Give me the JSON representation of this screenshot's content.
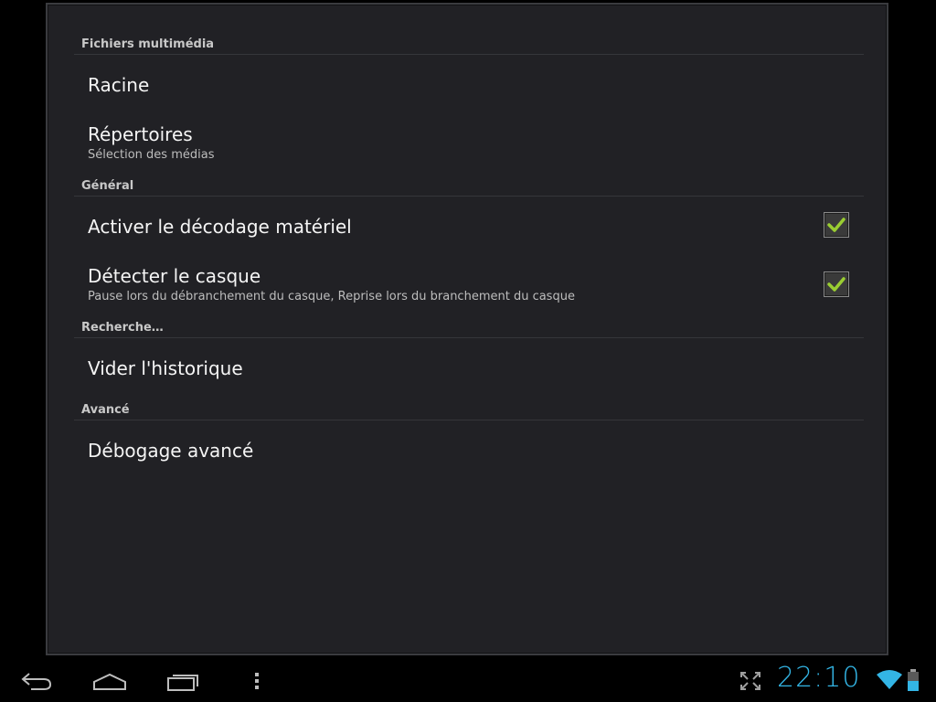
{
  "sections": {
    "media": {
      "header": "Fichiers multimédia"
    },
    "general": {
      "header": "Général"
    },
    "search": {
      "header": "Recherche…"
    },
    "advanced": {
      "header": "Avancé"
    }
  },
  "prefs": {
    "root": {
      "title": "Racine"
    },
    "directories": {
      "title": "Répertoires",
      "summary": "Sélection des médias"
    },
    "hw_decoding": {
      "title": "Activer le décodage matériel",
      "checked": true
    },
    "headset": {
      "title": "Détecter le casque",
      "summary": "Pause lors du débranchement du casque, Reprise lors du branchement du casque",
      "checked": true
    },
    "clear_history": {
      "title": "Vider l'historique"
    },
    "advanced_debug": {
      "title": "Débogage avancé"
    }
  },
  "statusbar": {
    "time": "22:10",
    "icons": [
      "fullscreen-icon",
      "wifi-icon",
      "battery-icon"
    ]
  },
  "navbar": {
    "icons": [
      "back-icon",
      "home-icon",
      "recent-apps-icon",
      "menu-icon"
    ]
  },
  "colors": {
    "accent": "#33b5e5",
    "check": "#9acd32",
    "panel": "#212125"
  }
}
